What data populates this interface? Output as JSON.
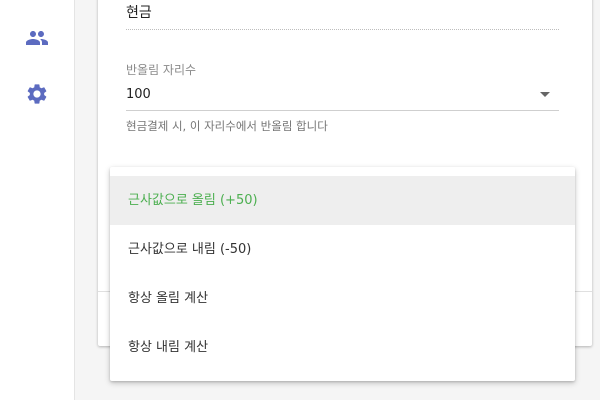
{
  "sidebar": {
    "icons": [
      {
        "name": "people-icon",
        "color": "#5c6bc0"
      },
      {
        "name": "gear-icon",
        "color": "#5c6bc0"
      }
    ]
  },
  "form": {
    "top_field_value": "현금",
    "rounding": {
      "label": "반올림 자리수",
      "value": "100",
      "helper": "현금결제 시, 이 자리수에서 반올림 합니다"
    }
  },
  "dropdown": {
    "selected_index": 0,
    "accent_color": "#4caf50",
    "options": [
      "근사값으로 올림 (+50)",
      "근사값으로 내림 (-50)",
      "항상 올림 계산",
      "항상 내림 계산"
    ]
  }
}
